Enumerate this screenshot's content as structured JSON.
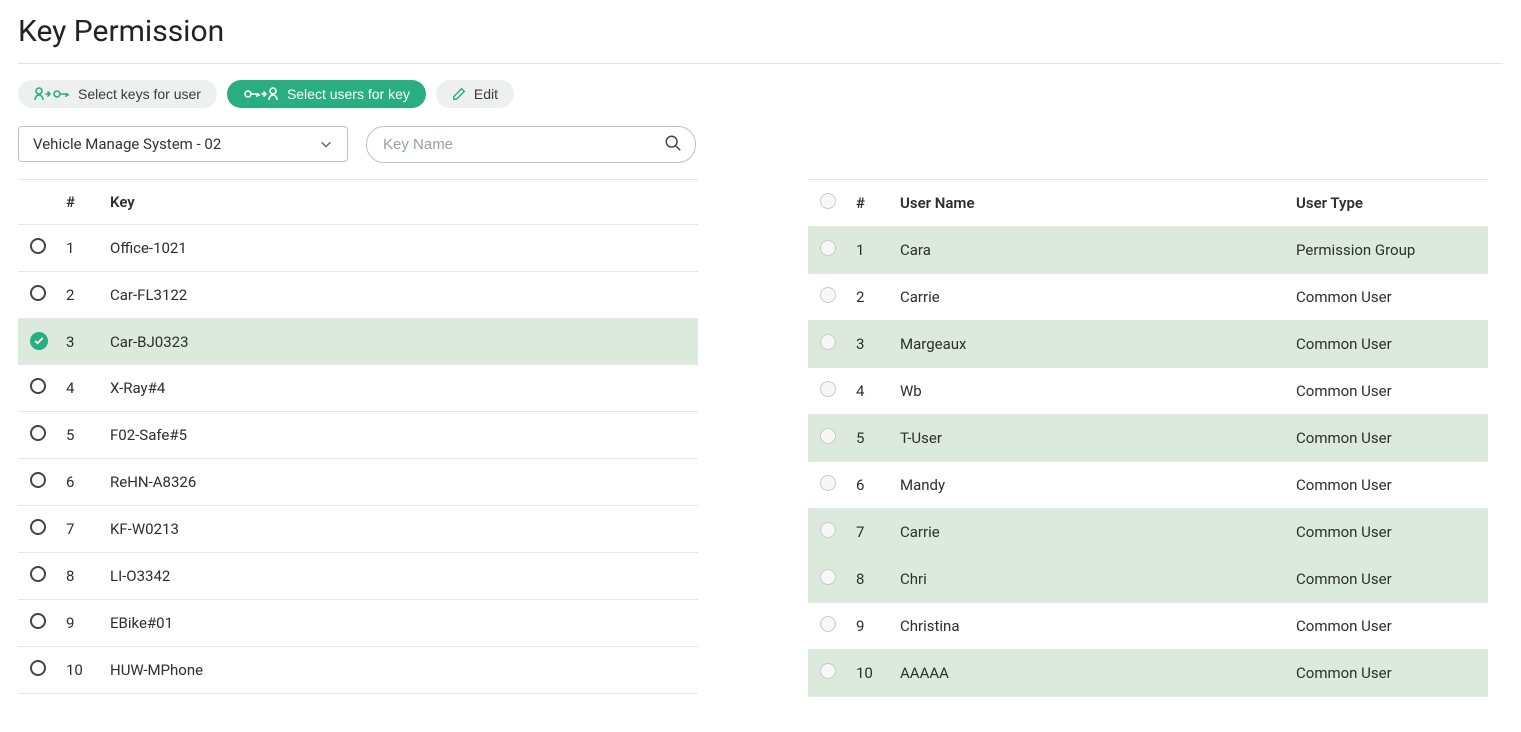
{
  "page": {
    "title": "Key Permission"
  },
  "toolbar": {
    "select_keys_label": "Select keys for user",
    "select_users_label": "Select users for key",
    "edit_label": "Edit"
  },
  "filters": {
    "system_select": "Vehicle Manage System - 02",
    "search_placeholder": "Key Name"
  },
  "keys_table": {
    "col_num": "#",
    "col_key": "Key",
    "rows": [
      {
        "n": "1",
        "key": "Office-1021",
        "selected": false
      },
      {
        "n": "2",
        "key": "Car-FL3122",
        "selected": false
      },
      {
        "n": "3",
        "key": "Car-BJ0323",
        "selected": true
      },
      {
        "n": "4",
        "key": "X-Ray#4",
        "selected": false
      },
      {
        "n": "5",
        "key": "F02-Safe#5",
        "selected": false
      },
      {
        "n": "6",
        "key": "ReHN-A8326",
        "selected": false
      },
      {
        "n": "7",
        "key": "KF-W0213",
        "selected": false
      },
      {
        "n": "8",
        "key": "LI-O3342",
        "selected": false
      },
      {
        "n": "9",
        "key": "EBike#01",
        "selected": false
      },
      {
        "n": "10",
        "key": "HUW-MPhone",
        "selected": false
      }
    ]
  },
  "users_table": {
    "col_num": "#",
    "col_name": "User Name",
    "col_type": "User Type",
    "rows": [
      {
        "n": "1",
        "name": "Cara",
        "type": "Permission Group",
        "selected": true
      },
      {
        "n": "2",
        "name": "Carrie",
        "type": "Common User",
        "selected": false
      },
      {
        "n": "3",
        "name": "Margeaux",
        "type": "Common User",
        "selected": true
      },
      {
        "n": "4",
        "name": "Wb",
        "type": "Common User",
        "selected": false
      },
      {
        "n": "5",
        "name": "T-User",
        "type": "Common User",
        "selected": true
      },
      {
        "n": "6",
        "name": "Mandy",
        "type": "Common User",
        "selected": false
      },
      {
        "n": "7",
        "name": "Carrie",
        "type": "Common User",
        "selected": true
      },
      {
        "n": "8",
        "name": "Chri",
        "type": "Common User",
        "selected": true
      },
      {
        "n": "9",
        "name": "Christina",
        "type": "Common User",
        "selected": false
      },
      {
        "n": "10",
        "name": "AAAAA",
        "type": "Common User",
        "selected": true
      }
    ]
  }
}
